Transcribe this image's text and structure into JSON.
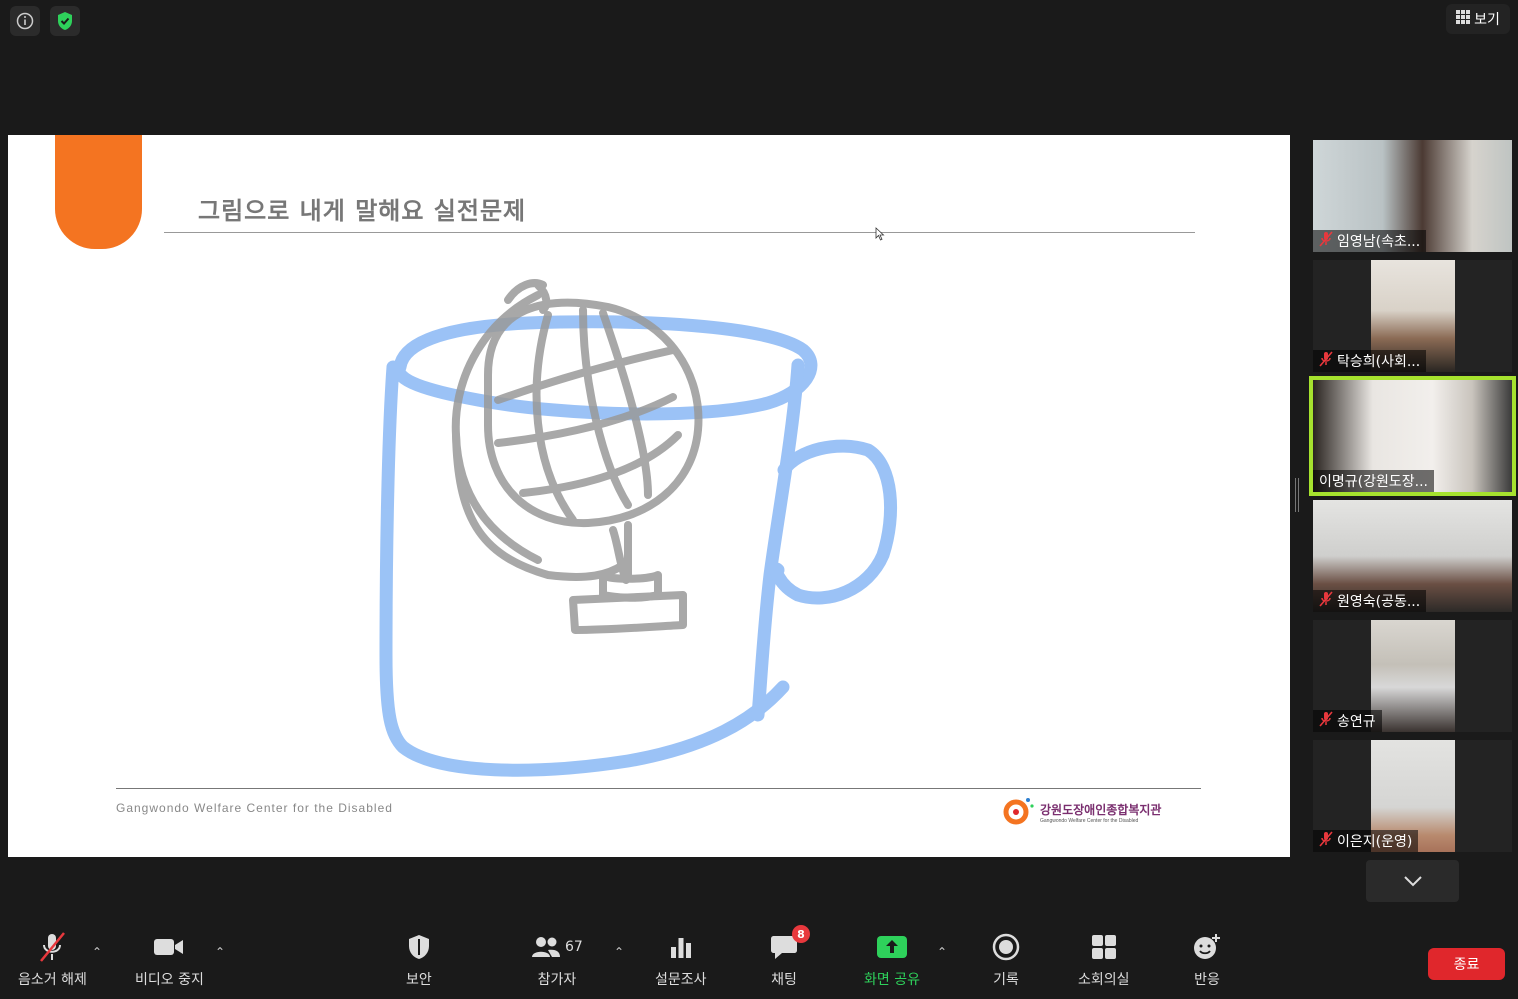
{
  "top": {
    "info_icon": "info-icon",
    "shield_icon": "security-shield-icon",
    "view_label": "보기"
  },
  "slide": {
    "title": "그림으로 내게 말해요 실전문제",
    "footer_text": "Gangwondo Welfare Center for the Disabled",
    "logo_text": "강원도장애인종합복지관",
    "logo_subtext": "Gangwondo Welfare Center for the Disabled"
  },
  "participants": [
    {
      "name": "임영남(속초...",
      "muted": true,
      "active": false
    },
    {
      "name": "탁승희(사회...",
      "muted": true,
      "active": false
    },
    {
      "name": "이명규(강원도장...",
      "muted": false,
      "active": true
    },
    {
      "name": "원영숙(공동...",
      "muted": true,
      "active": false
    },
    {
      "name": "송연규",
      "muted": true,
      "active": false
    },
    {
      "name": "이은지(운영)",
      "muted": true,
      "active": false
    }
  ],
  "toolbar": {
    "mute_label": "음소거 해제",
    "video_label": "비디오 중지",
    "security_label": "보안",
    "participants_label": "참가자",
    "participants_count": "67",
    "polls_label": "설문조사",
    "chat_label": "채팅",
    "chat_badge": "8",
    "share_label": "화면 공유",
    "record_label": "기록",
    "breakout_label": "소회의실",
    "reactions_label": "반응",
    "end_label": "종료"
  },
  "colors": {
    "accent_green": "#2ed15b",
    "active_border": "#a6e22e",
    "end_red": "#e0272c",
    "slide_orange": "#f47421"
  }
}
